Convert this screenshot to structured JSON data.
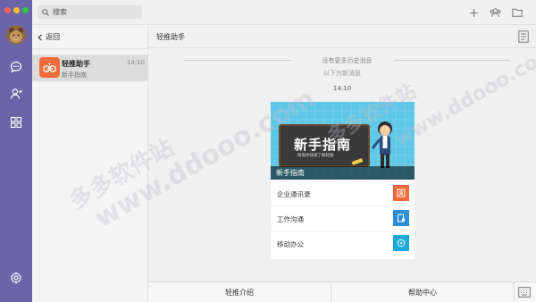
{
  "window": {
    "traffic_colors": [
      "#ff5f57",
      "#febc2e",
      "#28c840"
    ]
  },
  "search": {
    "placeholder": "搜索"
  },
  "list": {
    "back_label": "返回",
    "contacts": [
      {
        "name": "轻推助手",
        "subtitle": "新手指南",
        "time": "14:10"
      }
    ]
  },
  "chat": {
    "title": "轻推助手",
    "no_history": "没有更多历史消息",
    "new_messages": "以下为新消息",
    "time": "14:10",
    "card": {
      "banner_title": "新手指南",
      "banner_subtitle": "帮助你快速了解轻推",
      "caption": "新手指南",
      "rows": [
        {
          "label": "企业通讯录",
          "icon": "contacts-icon",
          "color": "#f26b3a"
        },
        {
          "label": "工作沟通",
          "icon": "chat-doc-icon",
          "color": "#2a8fd8"
        },
        {
          "label": "移动办公",
          "icon": "compass-icon",
          "color": "#1aa9d8"
        }
      ]
    }
  },
  "bottom": {
    "intro_label": "轻推介绍",
    "help_label": "帮助中心"
  },
  "watermark": [
    "多多软件站",
    "www.ddooo.com"
  ],
  "colors": {
    "rail": "#6b64a8",
    "accent": "#f26b3a"
  }
}
